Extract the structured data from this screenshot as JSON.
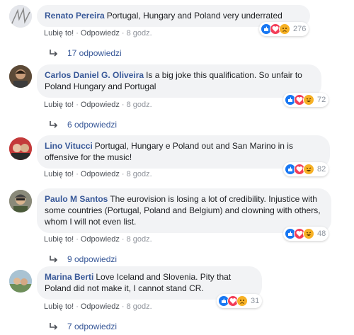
{
  "actions": {
    "like": "Lubię to!",
    "reply": "Odpowiedz",
    "sep": "·"
  },
  "comments": [
    {
      "author": "Renato Pereira",
      "text": "Portugal, Hungary and Poland very underrated",
      "time": "8 godz.",
      "reactions": [
        "like",
        "love",
        "sad"
      ],
      "reaction_count": "276",
      "replies": "17 odpowiedzi"
    },
    {
      "author": "Carlos Daniel G. Oliveira",
      "text": "Is a big joke this qualification. So unfair to Poland Hungary and Portugal",
      "time": "8 godz.",
      "reactions": [
        "like",
        "love",
        "haha"
      ],
      "reaction_count": "72",
      "replies": "6 odpowiedzi"
    },
    {
      "author": "Lino Vitucci",
      "text": "Portugal, Hungary e Poland out and San Marino in is offensive for the music!",
      "time": "8 godz.",
      "reactions": [
        "like",
        "love",
        "haha"
      ],
      "reaction_count": "82",
      "replies": ""
    },
    {
      "author": "Paulo M Santos",
      "text": "The eurovision is losing a lot of credibility. Injustice with some countries (Portugal, Poland and Belgium) and clowning with others, whom I will not even list.",
      "time": "8 godz.",
      "reactions": [
        "like",
        "love",
        "haha"
      ],
      "reaction_count": "48",
      "replies": "9 odpowiedzi"
    },
    {
      "author": "Marina Berti",
      "text": "Love Iceland and Slovenia. Pity that Poland did not make it, I cannot stand CR.",
      "time": "8 godz.",
      "reactions": [
        "like",
        "love",
        "sad"
      ],
      "reaction_count": "31",
      "replies": "7 odpowiedzi"
    }
  ],
  "colors": {
    "link": "#385898",
    "bubble": "#f2f3f5",
    "like": "#1877f2",
    "love": "#f33e58",
    "emoji": "#f7b125"
  }
}
